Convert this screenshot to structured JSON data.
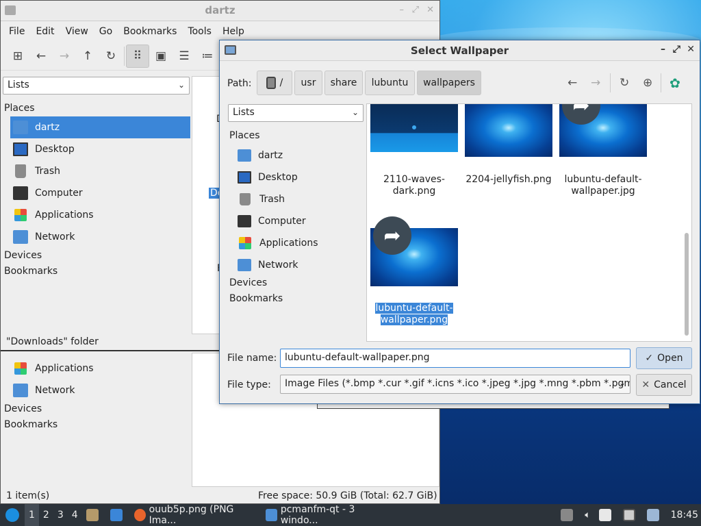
{
  "fm": {
    "title": "dartz",
    "menu": [
      "File",
      "Edit",
      "View",
      "Go",
      "Bookmarks",
      "Tools",
      "Help"
    ],
    "side_mode": "Lists",
    "places_heading": "Places",
    "places": [
      {
        "label": "dartz",
        "icon": "home-folder-icon"
      },
      {
        "label": "Desktop",
        "icon": "desktop-icon"
      },
      {
        "label": "Trash",
        "icon": "trash-icon"
      },
      {
        "label": "Computer",
        "icon": "computer-icon"
      },
      {
        "label": "Applications",
        "icon": "applications-icon"
      },
      {
        "label": "Network",
        "icon": "network-icon"
      }
    ],
    "devices_heading": "Devices",
    "bookmarks_heading": "Bookmarks",
    "status_folder": "\"Downloads\" folder",
    "lower_places": [
      {
        "label": "Applications",
        "icon": "applications-icon"
      },
      {
        "label": "Network",
        "icon": "network-icon"
      }
    ],
    "items_count": "1 item(s)",
    "free_space": "Free space: 50.9 GiB (Total: 62.7 GiB)",
    "pane_fragments": [
      "D",
      "Do",
      "F"
    ]
  },
  "dialog": {
    "title": "Select Wallpaper",
    "path_label": "Path:",
    "crumbs": [
      "/",
      "usr",
      "share",
      "lubuntu",
      "wallpapers"
    ],
    "side_mode": "Lists",
    "places_heading": "Places",
    "places": [
      {
        "label": "dartz",
        "icon": "home-folder-icon"
      },
      {
        "label": "Desktop",
        "icon": "desktop-icon"
      },
      {
        "label": "Trash",
        "icon": "trash-icon"
      },
      {
        "label": "Computer",
        "icon": "computer-icon"
      },
      {
        "label": "Applications",
        "icon": "applications-icon"
      },
      {
        "label": "Network",
        "icon": "network-icon"
      }
    ],
    "devices_heading": "Devices",
    "bookmarks_heading": "Bookmarks",
    "files": [
      {
        "name_l1": "2110-waves-",
        "name_l2": "dark.png"
      },
      {
        "name_l1": "2204-jellyfish.png",
        "name_l2": ""
      },
      {
        "name_l1": "lubuntu-default-",
        "name_l2": "wallpaper.jpg"
      },
      {
        "name_l1": "lubuntu-default-",
        "name_l2": "wallpaper.png"
      }
    ],
    "file_name_label": "File name:",
    "file_name_value": "lubuntu-default-wallpaper.png",
    "file_type_label": "File type:",
    "file_type_value": "Image Files (*.bmp *.cur *.gif *.icns *.ico *.jpeg *.jpg *.mng *.pbm *.pgm",
    "open_label": "Open",
    "cancel_label": "Cancel"
  },
  "taskbar": {
    "workspaces": [
      "1",
      "2",
      "3",
      "4"
    ],
    "task1": "ouub5p.png (PNG Ima...",
    "task2": "pcmanfm-qt - 3 windo...",
    "clock": "18:45"
  }
}
